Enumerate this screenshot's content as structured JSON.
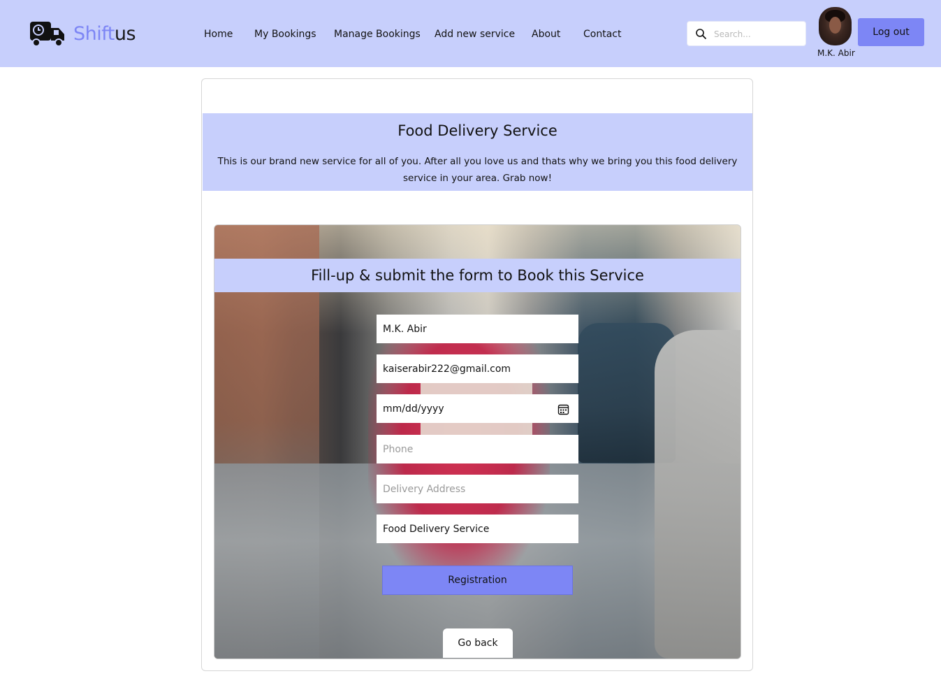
{
  "header": {
    "brand_part1": "Shift",
    "brand_part2": "us",
    "logo_icon": "truck-clock-icon",
    "nav": [
      {
        "label": "Home"
      },
      {
        "label": "My Bookings"
      },
      {
        "label": "Manage Bookings"
      },
      {
        "label": "Add new service"
      },
      {
        "label": "About"
      },
      {
        "label": "Contact"
      }
    ],
    "search": {
      "placeholder": "Search...",
      "icon": "search-icon"
    },
    "user_name": "M.K. Abir",
    "logout_label": "Log out"
  },
  "service": {
    "title": "Food Delivery Service",
    "description": "This is our brand new service for all of you. After all you love us and thats why we bring you this food delivery service in your area. Grab now!"
  },
  "form": {
    "heading": "Fill-up & submit the form to Book this Service",
    "name_value": "M.K. Abir",
    "email_value": "kaiserabir222@gmail.com",
    "date_placeholder": "mm/dd/yyyy",
    "phone_placeholder": "Phone",
    "address_placeholder": "Delivery Address",
    "service_value": "Food Delivery Service",
    "submit_label": "Registration",
    "back_label": "Go back"
  },
  "colors": {
    "header_bg": "#c7cffc",
    "accent": "#7d86f5"
  }
}
